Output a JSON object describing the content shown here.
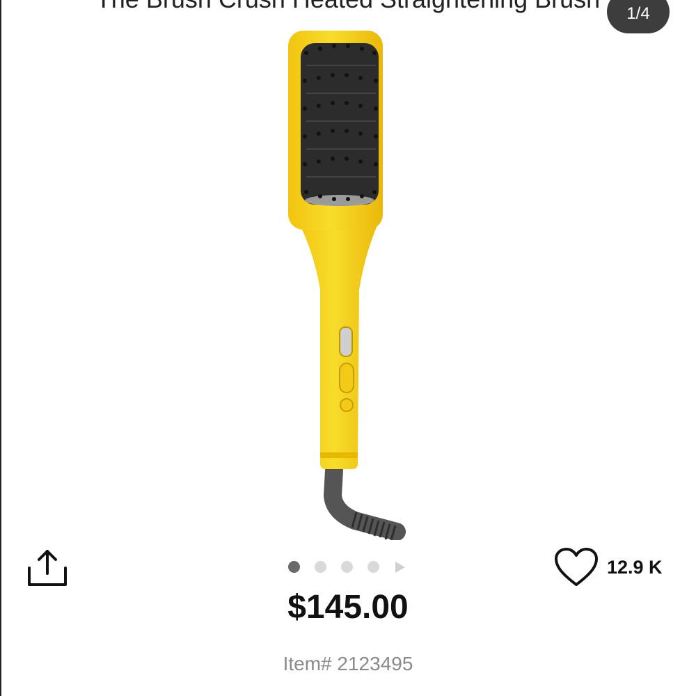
{
  "product": {
    "title": "The Brush Crush Heated Straightening Brush",
    "image_alt": "Yellow heated straightening brush",
    "price": "$145.00",
    "item_label": "Item# 2123495"
  },
  "gallery": {
    "counter": "1/4",
    "current_index": 1,
    "total_images": 4
  },
  "likes": {
    "count": "12.9 K"
  },
  "icons": {
    "share": "share-icon",
    "heart": "heart-outline-icon",
    "play": "play-icon"
  },
  "colors": {
    "brush_yellow": "#F5D21E",
    "badge_bg": "#3d3d3d",
    "dot_active": "#6a6a6a",
    "dot_inactive": "#d9d9d9",
    "item_text": "#8a8a8a"
  }
}
